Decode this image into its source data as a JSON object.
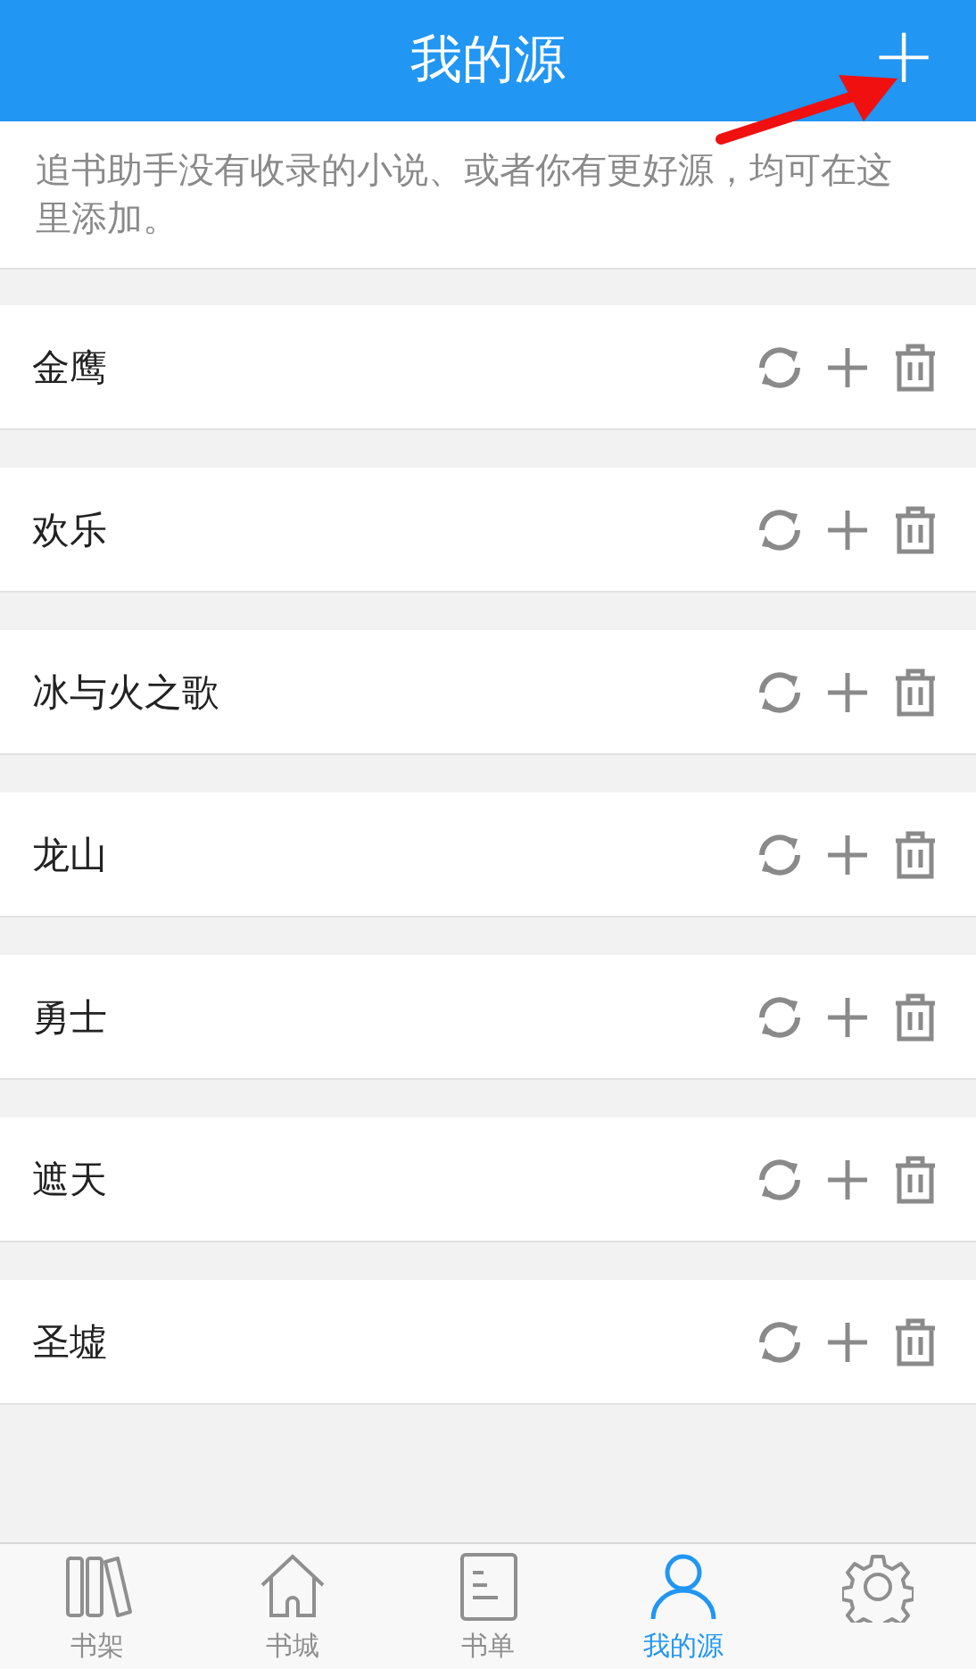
{
  "header": {
    "title": "我的源",
    "add_button": "+"
  },
  "hint": "追书助手没有收录的小说、或者你有更好源，均可在这里添加。",
  "sources": [
    {
      "name": "金鹰"
    },
    {
      "name": "欢乐"
    },
    {
      "name": "冰与火之歌"
    },
    {
      "name": "龙山"
    },
    {
      "name": "勇士"
    },
    {
      "name": "遮天"
    },
    {
      "name": "圣墟"
    }
  ],
  "tab_bar": [
    {
      "kind": "shelf",
      "label": "书架",
      "selected": false
    },
    {
      "kind": "home",
      "label": "书城",
      "selected": false
    },
    {
      "kind": "list",
      "label": "书单",
      "selected": false
    },
    {
      "kind": "person",
      "label": "我的源",
      "selected": true
    },
    {
      "kind": "gear",
      "selected": false
    }
  ]
}
